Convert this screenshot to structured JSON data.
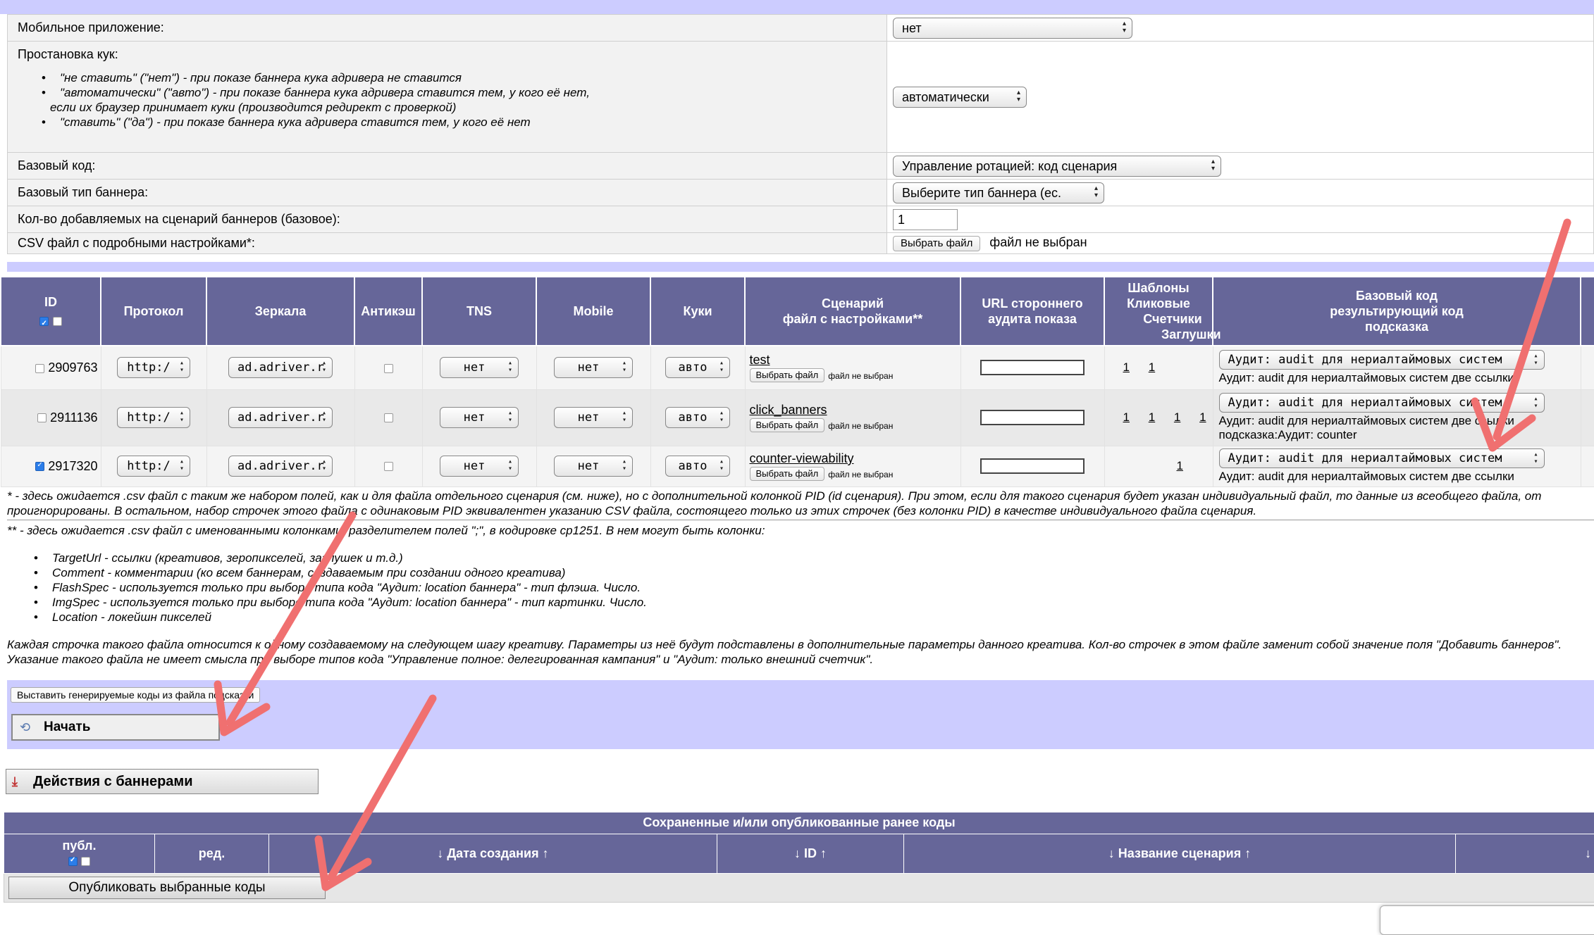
{
  "settings": {
    "mobile_label": "Мобильное приложение:",
    "mobile_value": "нет",
    "cookie_label": "Простановка кук:",
    "cookie_items": [
      "\"не ставить\" (\"нет\") - при показе баннера кука адривера не ставится",
      "\"автоматически\" (\"авто\") - при показе баннера кука адривера ставится тем, у кого её нет,",
      "\"ставить\" (\"да\") - при показе баннера кука адривера ставится тем, у кого её нет"
    ],
    "cookie_item2_cont": "если их браузер принимает куки (производится редирект с проверкой)",
    "cookie_value": "автоматически",
    "base_code_label": "Базовый код:",
    "base_code_value": "Управление ротацией: код сценария",
    "base_type_label": "Базовый тип баннера:",
    "base_type_value": "Выберите тип баннера (ес.",
    "count_label": "Кол-во добавляемых на сценарий баннеров (базовое):",
    "count_value": "1",
    "csv_label": "CSV файл с подробными настройками*:",
    "csv_btn": "Выбрать файл",
    "csv_status": "файл не выбран"
  },
  "scenarios": {
    "headers": {
      "id": "ID",
      "protocol": "Протокол",
      "mirrors": "Зеркала",
      "anticache": "Антикэш",
      "tns": "TNS",
      "mobile": "Mobile",
      "cookies": "Куки",
      "scenario_l1": "Сценарий",
      "scenario_l2": "файл с настройками**",
      "url_l1": "URL стороннего",
      "url_l2": "аудита показа",
      "tpl_l1": "Шаблоны",
      "tpl_l2": "Кликовые",
      "tpl_l3": "Счетчики",
      "tpl_l4": "Заглушки",
      "base_l1": "Базовый код",
      "base_l2": "результирующий код",
      "base_l3": "подсказка"
    },
    "rows": [
      {
        "id": "2909763",
        "protocol": "http:/",
        "mirror": "ad.adriver.r",
        "tns": "нет",
        "mobile": "нет",
        "cookie": "авто",
        "name": "test",
        "file_btn": "Выбрать файл",
        "file_status": "файл не выбран",
        "t1": "1",
        "t2": "",
        "t3": "1",
        "t4": "",
        "code": "Аудит: audit для нериалтаймовых систем",
        "result": "Аудит: audit для нериалтаймовых систем две ссылки",
        "hint": ""
      },
      {
        "id": "2911136",
        "protocol": "http:/",
        "mirror": "ad.adriver.r",
        "tns": "нет",
        "mobile": "нет",
        "cookie": "авто",
        "name": "click_banners",
        "file_btn": "Выбрать файл",
        "file_status": "файл не выбран",
        "t1": "1",
        "t2": "1",
        "t3": "1",
        "t4": "1",
        "code": "Аудит: audit для нериалтаймовых систем",
        "result": "Аудит: audit для нериалтаймовых систем две ссылки",
        "hint": "подсказка:Аудит: counter"
      },
      {
        "id": "2917320",
        "protocol": "http:/",
        "mirror": "ad.adriver.r",
        "tns": "нет",
        "mobile": "нет",
        "cookie": "авто",
        "name": "counter-viewability",
        "file_btn": "Выбрать файл",
        "file_status": "файл не выбран",
        "t1": "",
        "t2": "",
        "t3": "1",
        "t4": "",
        "code": "Аудит: audit для нериалтаймовых систем",
        "result": "Аудит: audit для нериалтаймовых систем две ссылки",
        "hint": ""
      }
    ]
  },
  "notes": {
    "csv_note_1": "* - здесь ожидается .csv файл с таким же набором полей, как и для файла отдельного сценария (см. ниже), но с дополнительной колонкой PID (id сценария). При этом, если для такого сценария будет указан индивидуальный файл, то данные из всеобщего файла, от",
    "csv_note_2": "проигнорированы. В остальном, набор строчек этого файла с одинаковым PID эквивалентен указанию CSV файла, состоящего только из этих строчек (без колонки PID) в качестве индивидуального файла сценария.",
    "csv_named": "** - здесь ожидается .csv файл с именованными колонками, разделителем полей \";\", в кодировке cp1251. В нем могут быть колонки:",
    "columns": [
      "TargetUrl - ссылки (креативов, зеропикселей, заглушек и т.д.)",
      "Comment - комментарии (ко всем баннерам, создаваемым при создании одного креатива)",
      "FlashSpec - используется только при выборе типа кода \"Аудит: location баннера\" - тип флэша. Число.",
      "ImgSpec - используется только при выборе типа кода \"Аудит: location баннера\" - тип картинки. Число.",
      "Location - локейшн пикселей"
    ],
    "each_row_1": "Каждая строчка такого файла относится к одному создаваемому на следующем шагу креативу. Параметры из неё будут подставлены в дополнительные параметры данного креатива. Кол-во строчек в этом файле заменит собой значение поля \"Добавить баннеров\".",
    "each_row_2": "Указание такого файла не имеет смысла при выборе типов кода \"Управление полное: делегированная кампания\" и \"Аудит: только внешний счетчик\"."
  },
  "buttons": {
    "set_codes": "Выставить генерируемые коды из файла подсказки",
    "start": "Начать",
    "actions": "Действия с баннерами",
    "publish": "Опубликовать выбранные коды"
  },
  "saved": {
    "title": "Сохраненные и/или опубликованные ранее коды",
    "col_pub": "публ.",
    "col_edit": "ред.",
    "col_date": "↓ Дата создания ↑",
    "col_id": "↓ ID ↑",
    "col_name": "↓ Название сценария ↑",
    "col_last": "↓"
  },
  "colors": {
    "header_bg": "#666699",
    "band_bg": "#ccccff",
    "arrow": "#f07070"
  }
}
